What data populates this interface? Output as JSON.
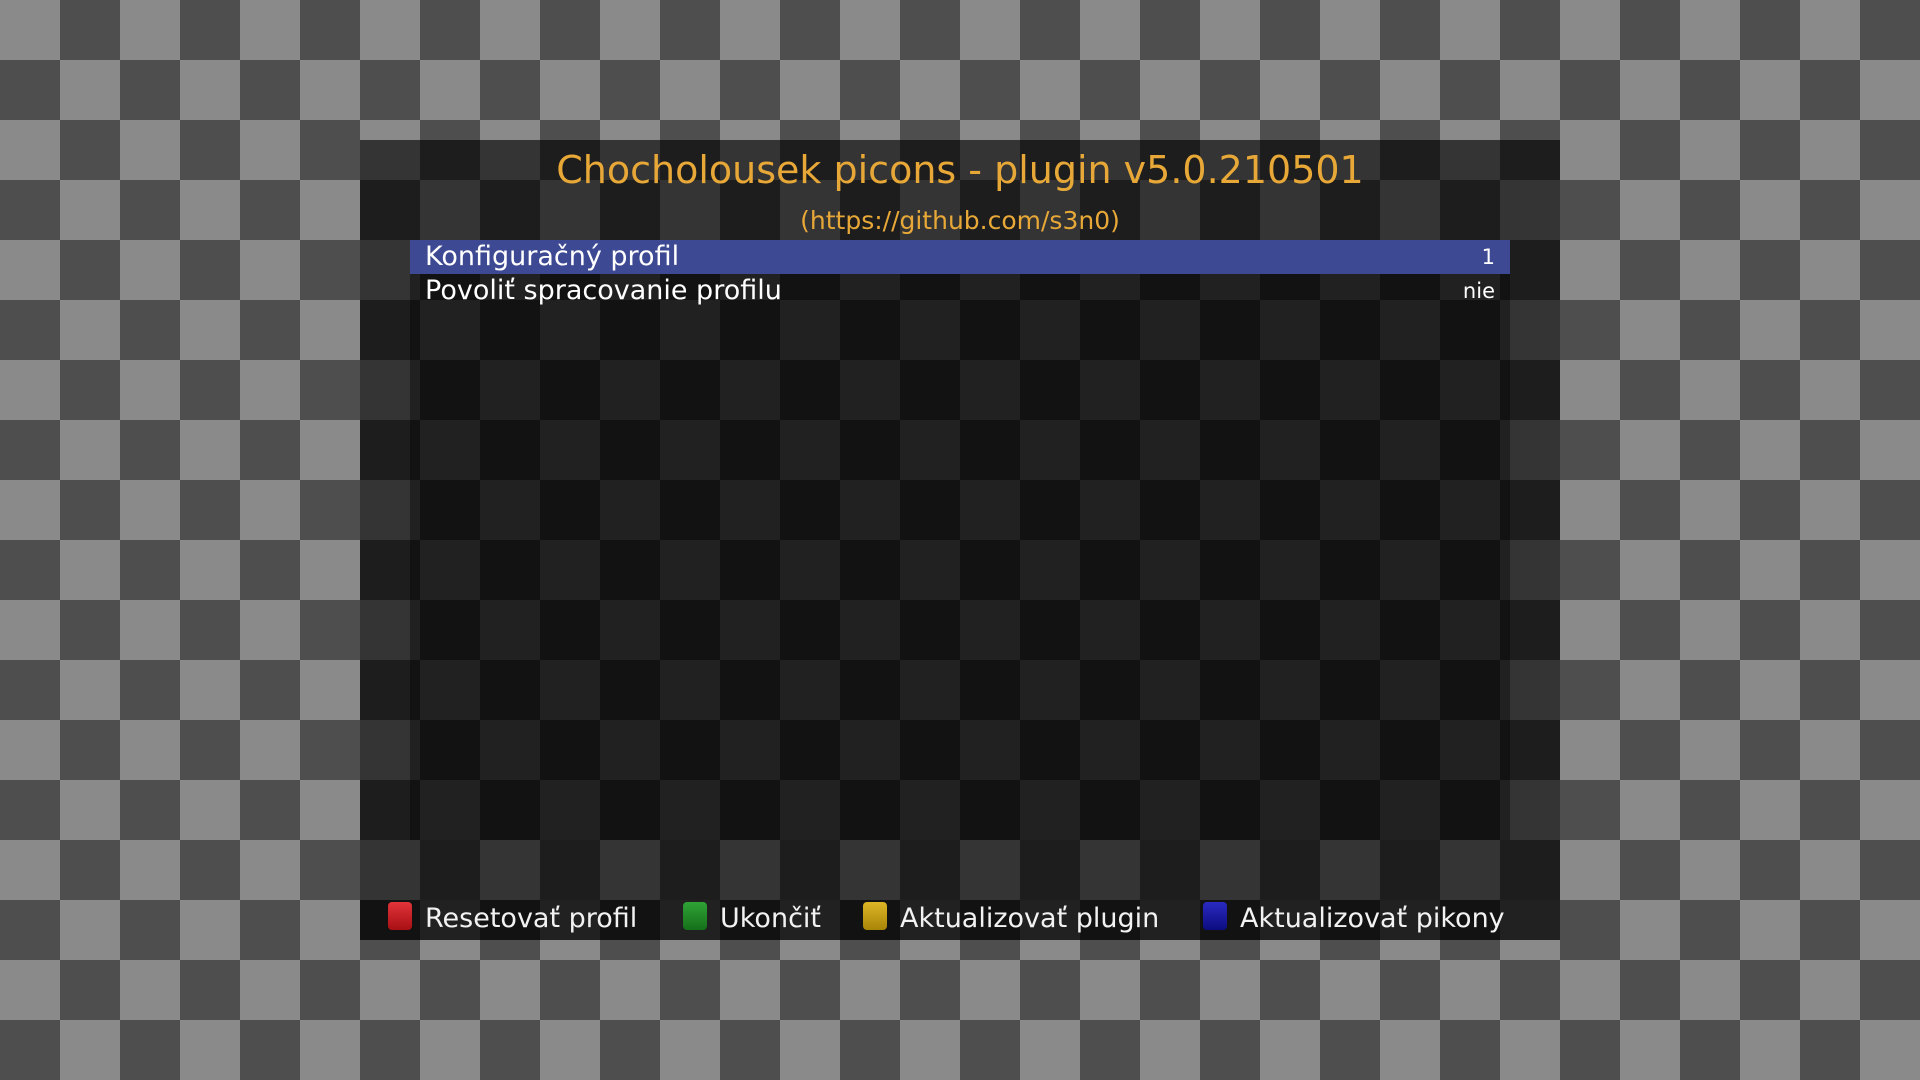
{
  "header": {
    "title": "Chocholousek picons - plugin v5.0.210501",
    "subtitle": "(https://github.com/s3n0)"
  },
  "settings": [
    {
      "label": "Konfiguračný profil",
      "value": "1",
      "selected": true
    },
    {
      "label": "Povoliť spracovanie profilu",
      "value": "nie",
      "selected": false
    }
  ],
  "footer": {
    "buttons": [
      {
        "color_name": "red",
        "icon": "red-key-icon",
        "color": "#c8191e",
        "label": "Resetovať profil"
      },
      {
        "color_name": "green",
        "icon": "green-key-icon",
        "color": "#1f8a24",
        "label": "Ukončiť"
      },
      {
        "color_name": "yellow",
        "icon": "yellow-key-icon",
        "color": "#c9a011",
        "label": "Aktualizovať plugin"
      },
      {
        "color_name": "blue",
        "icon": "blue-key-icon",
        "color": "#1414a0",
        "label": "Aktualizovať pikony"
      }
    ]
  },
  "colors": {
    "title": "#e8a838",
    "selection": "#3d4a93"
  }
}
